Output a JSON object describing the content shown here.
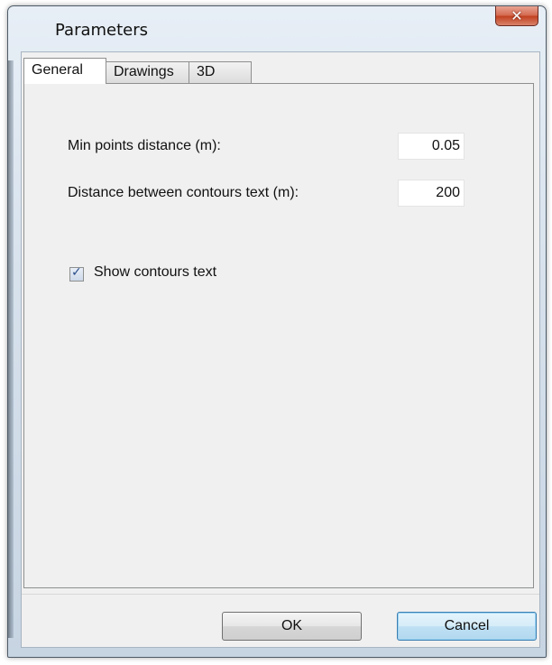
{
  "window": {
    "title": "Parameters",
    "close_glyph": "✕"
  },
  "tabs": [
    {
      "label": "General",
      "active": true
    },
    {
      "label": "Drawings",
      "active": false
    },
    {
      "label": "3D",
      "active": false
    }
  ],
  "general": {
    "min_points_label": "Min points distance (m):",
    "min_points_value": "0.05",
    "contour_text_label": "Distance between contours text (m):",
    "contour_text_value": "200",
    "show_contours_label": "Show contours text",
    "show_contours_checked": true,
    "check_glyph": "✓"
  },
  "buttons": {
    "ok": "OK",
    "cancel": "Cancel"
  },
  "icons": {
    "close": "close-icon",
    "check": "checkmark-icon"
  }
}
